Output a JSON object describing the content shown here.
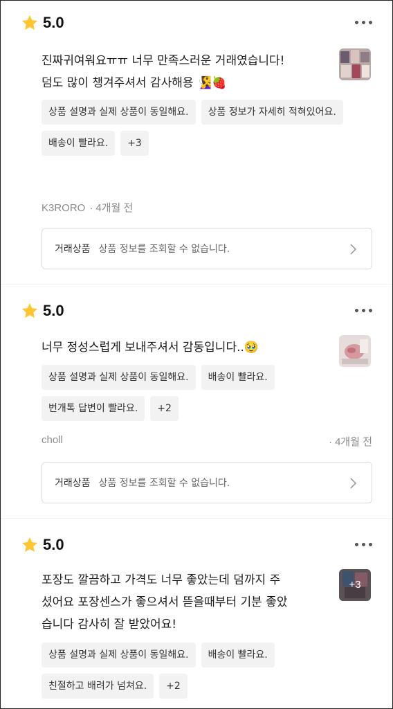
{
  "reviews": [
    {
      "score": "5.0",
      "text_lines": [
        "진짜귀여워요ㅠㅠ 너무 만족스러운 거래였습니다!",
        "덤도 많이 챙겨주셔서 감사해용 🧏‍♀️🍓"
      ],
      "tags": [
        "상품 설명과 실제 상품이 동일해요.",
        "상품 정보가 자세히 적혀있어요.",
        "배송이 빨라요.",
        "+3"
      ],
      "author": "K3RORO",
      "date": "4개월 전",
      "product_label": "거래상품",
      "product_text": "상품 정보를 조회할 수 없습니다.",
      "thumb_overlay": ""
    },
    {
      "score": "5.0",
      "text_lines": [
        "너무 정성스럽게 보내주셔서 감동입니다..🥹"
      ],
      "tags": [
        "상품 설명과 실제 상품이 동일해요.",
        "배송이 빨라요.",
        "번개톡 답변이 빨라요.",
        "+2"
      ],
      "author": "choll",
      "date": "4개월 전",
      "product_label": "거래상품",
      "product_text": "상품 정보를 조회할 수 없습니다.",
      "thumb_overlay": ""
    },
    {
      "score": "5.0",
      "text_lines": [
        "포장도 깔끔하고 가격도 너무 좋았는데 덤까지 주",
        "셨어요 포장센스가 좋으셔서 뜯을때부터 기분 좋았",
        "습니다 감사히 잘 받았어요!"
      ],
      "tags": [
        "상품 설명과 실제 상품이 동일해요.",
        "배송이 빨라요.",
        "친절하고 배려가 넘쳐요.",
        "+2"
      ],
      "thumb_overlay": "+3"
    }
  ],
  "colors": {
    "star": "#FFC533",
    "tag_bg": "#F2F2F2",
    "meta": "#8C8C8C",
    "border": "#DCDCDC"
  }
}
